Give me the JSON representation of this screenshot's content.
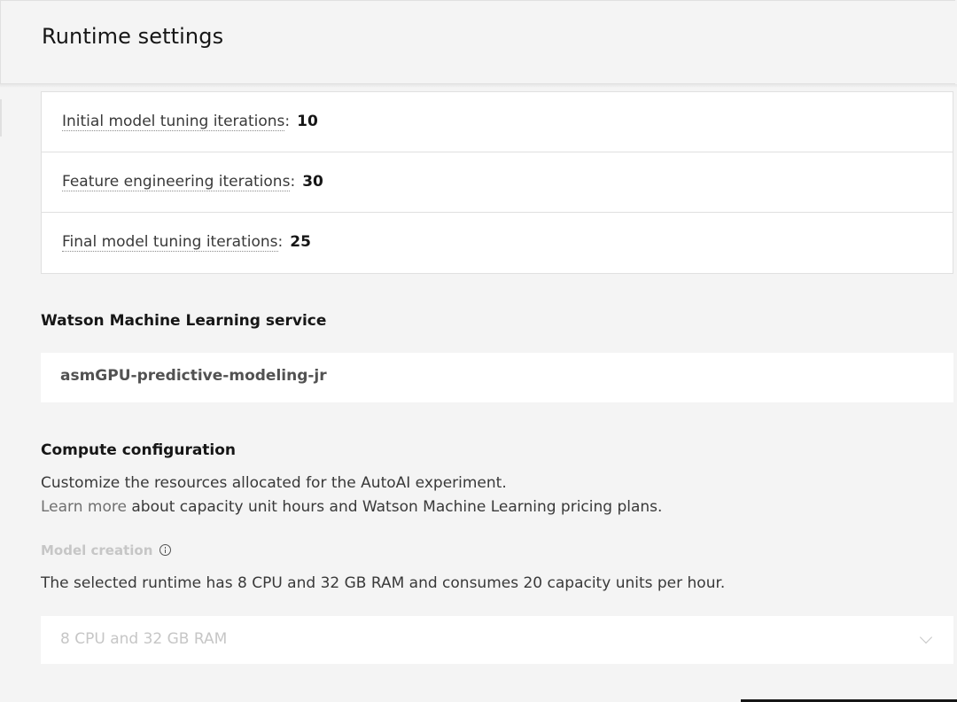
{
  "header": {
    "title": "Runtime settings"
  },
  "iterations": [
    {
      "label": "Initial model tuning iterations",
      "value": "10"
    },
    {
      "label": "Feature engineering iterations",
      "value": "30"
    },
    {
      "label": "Final model tuning iterations",
      "value": "25"
    }
  ],
  "wml": {
    "heading": "Watson Machine Learning service",
    "service_name": "asmGPU-predictive-modeling-jr"
  },
  "compute": {
    "heading": "Compute configuration",
    "description": "Customize the resources allocated for the AutoAI experiment.",
    "learn_more": "Learn more",
    "learn_more_suffix": " about capacity unit hours and Watson Machine Learning pricing plans.",
    "model_creation_label": "Model creation",
    "info_icon": "info-icon",
    "runtime_summary": "The selected runtime has 8 CPU and 32 GB RAM and consumes 20 capacity units per hour.",
    "runtime_select_value": "8 CPU and 32 GB RAM"
  }
}
